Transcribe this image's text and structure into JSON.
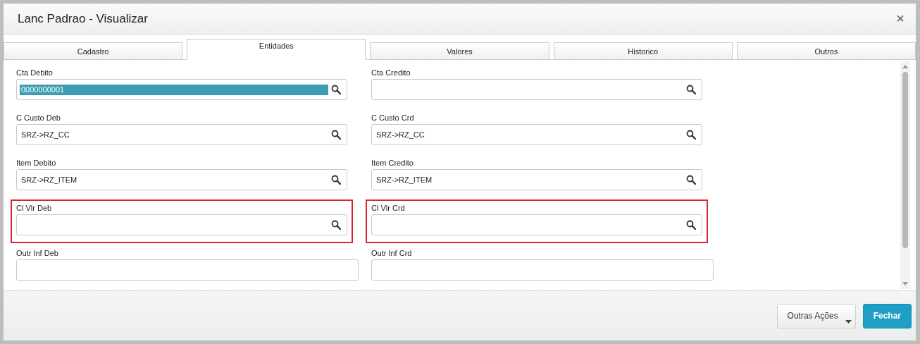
{
  "window": {
    "title": "Lanc Padrao - Visualizar",
    "close": "×"
  },
  "tabs": [
    {
      "label": "Cadastro",
      "selected": false
    },
    {
      "label": "Entidades",
      "selected": true
    },
    {
      "label": "Valores",
      "selected": false
    },
    {
      "label": "Historico",
      "selected": false
    },
    {
      "label": "Outros",
      "selected": false
    }
  ],
  "rows": [
    {
      "fields": [
        {
          "label": "Cta Debito",
          "value": "0000000001",
          "kind": "lookup",
          "text_selected": true,
          "highlighted": false
        },
        {
          "label": "Cta Credito",
          "kind": "lookup",
          "highlighted": false
        }
      ]
    },
    {
      "fields": [
        {
          "label": "C Custo Deb",
          "value": "SRZ->RZ_CC",
          "kind": "lookup",
          "text_selected": false,
          "highlighted": false
        },
        {
          "label": "C Custo Crd",
          "value": "SRZ->RZ_CC",
          "kind": "lookup",
          "text_selected": false,
          "highlighted": false
        }
      ]
    },
    {
      "fields": [
        {
          "label": "Item Debito",
          "value": "SRZ->RZ_ITEM",
          "kind": "lookup",
          "text_selected": false,
          "highlighted": false
        },
        {
          "label": "Item Credito",
          "value": "SRZ->RZ_ITEM",
          "kind": "lookup",
          "text_selected": false,
          "highlighted": false
        }
      ]
    },
    {
      "fields": [
        {
          "label": "Cl Vlr Deb",
          "kind": "lookup",
          "highlighted": true
        },
        {
          "label": "Cl Vlr Crd",
          "kind": "lookup",
          "highlighted": true
        }
      ]
    },
    {
      "fields": [
        {
          "label": "Outr Inf Deb",
          "kind": "text",
          "highlighted": false
        },
        {
          "label": "Outr Inf Crd",
          "kind": "text",
          "highlighted": false
        }
      ]
    }
  ],
  "buttons": [
    {
      "label": "Outras Ações",
      "kind": "menu"
    },
    {
      "label": "Fechar",
      "kind": "primary"
    }
  ]
}
